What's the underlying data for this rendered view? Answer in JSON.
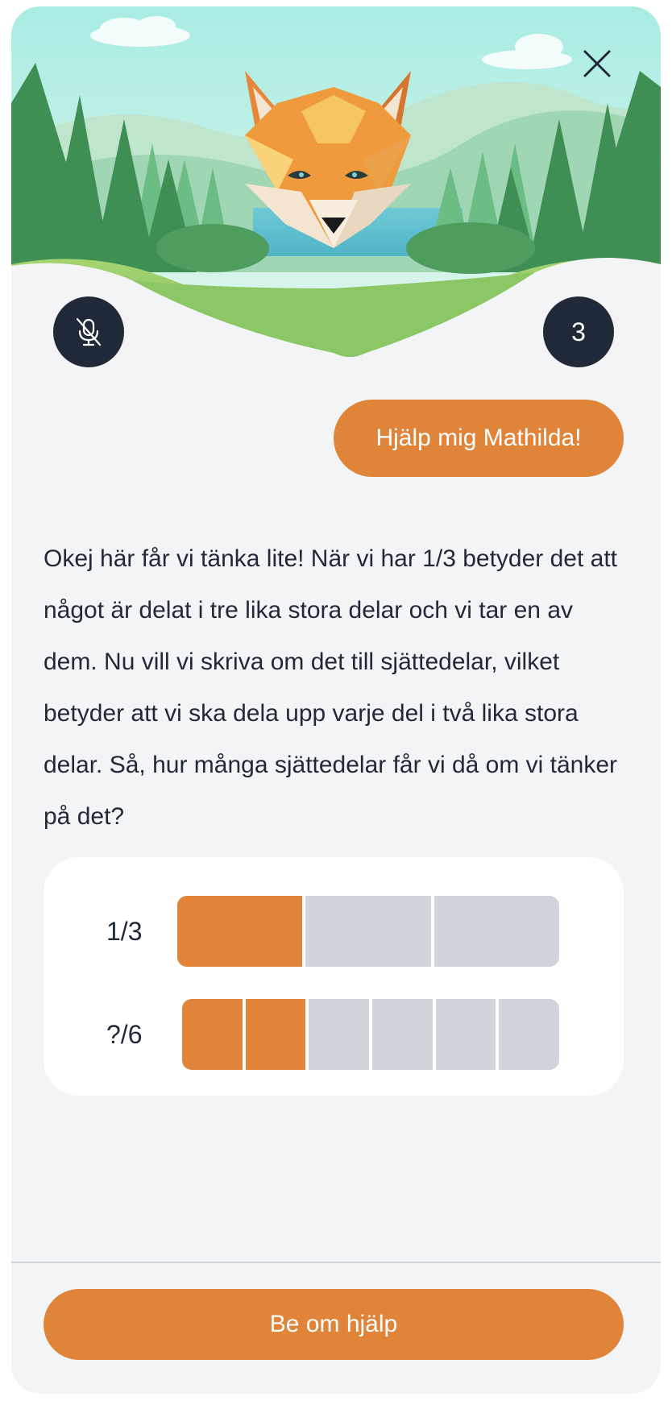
{
  "header": {
    "close_icon": "close-icon",
    "mascot": "fox-head",
    "mic_icon": "mic-off-icon",
    "counter": "3"
  },
  "chat": {
    "user_message": "Hjälp mig Mathilda!",
    "assistant_message": "Okej här får vi tänka lite! När vi har 1/3 betyder det att något är delat i tre lika stora delar och vi tar en av dem. Nu vill vi skriva om det till sjättedelar, vilket betyder att vi ska dela upp varje del i två lika stora delar. Så, hur många sjättedelar får vi då om vi tänker på det?"
  },
  "fractions": [
    {
      "label": "1/3",
      "parts": 3,
      "filled": 1
    },
    {
      "label": "?/6",
      "parts": 6,
      "filled": 2
    }
  ],
  "footer": {
    "help_button": "Be om hjälp"
  },
  "colors": {
    "accent": "#e0843a",
    "dark": "#1f2937",
    "empty_segment": "#d1d5db",
    "background": "#f3f4f6"
  }
}
